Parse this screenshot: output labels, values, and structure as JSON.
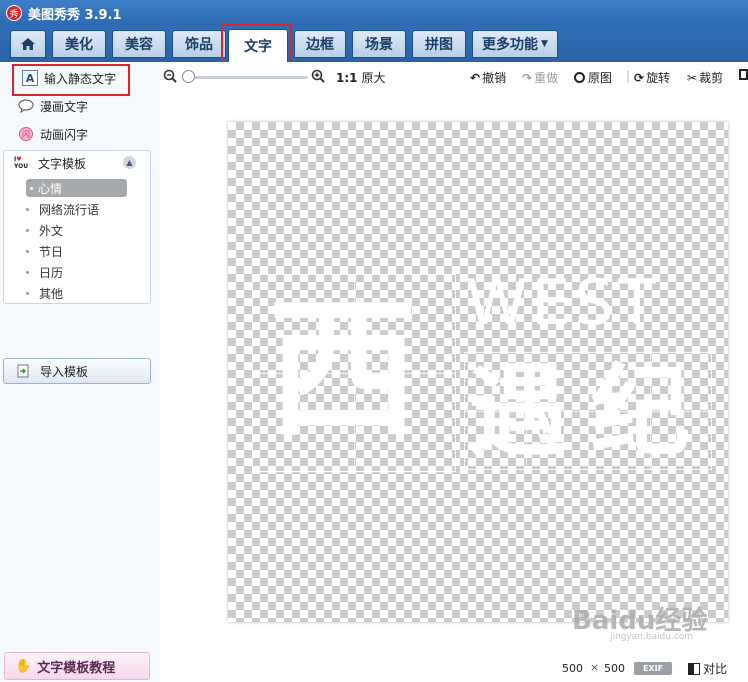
{
  "app": {
    "title": "美图秀秀 3.9.1",
    "icon_glyph": "秀"
  },
  "tabs": [
    {
      "label": "美化"
    },
    {
      "label": "美容"
    },
    {
      "label": "饰品"
    },
    {
      "label": "文字"
    },
    {
      "label": "边框"
    },
    {
      "label": "场景"
    },
    {
      "label": "拼图"
    },
    {
      "label": "更多功能"
    }
  ],
  "active_tab": "文字",
  "sidebar": {
    "items": [
      {
        "label": "输入静态文字",
        "icon": "text-a-icon"
      },
      {
        "label": "漫画文字",
        "icon": "speech-bubble-icon"
      },
      {
        "label": "动画闪字",
        "icon": "flash-text-icon"
      }
    ],
    "template": {
      "title": "文字模板",
      "subitems": [
        "心情",
        "网络流行语",
        "外文",
        "节日",
        "日历",
        "其他"
      ],
      "selected": "心情"
    },
    "import_label": "导入模板",
    "tutorial_label": "文字模板教程"
  },
  "toolbar": {
    "ratio_label": "1:1",
    "original_size_label": "原大",
    "undo_label": "撤销",
    "redo_label": "重做",
    "original_label": "原图",
    "rotate_label": "旋转",
    "crop_label": "裁剪"
  },
  "canvas": {
    "big_char": "西",
    "word": "WEST",
    "chars": [
      "遇",
      "纪"
    ]
  },
  "status": {
    "width": "500",
    "times": "×",
    "height": "500",
    "exif": "EXIF",
    "compare_label": "对比"
  },
  "watermark": {
    "text": "Baidu经验",
    "sub": "jingyan.baidu.com"
  },
  "colors": {
    "accent_red": "#d9262c",
    "title_blue": "#2d6ab4"
  }
}
